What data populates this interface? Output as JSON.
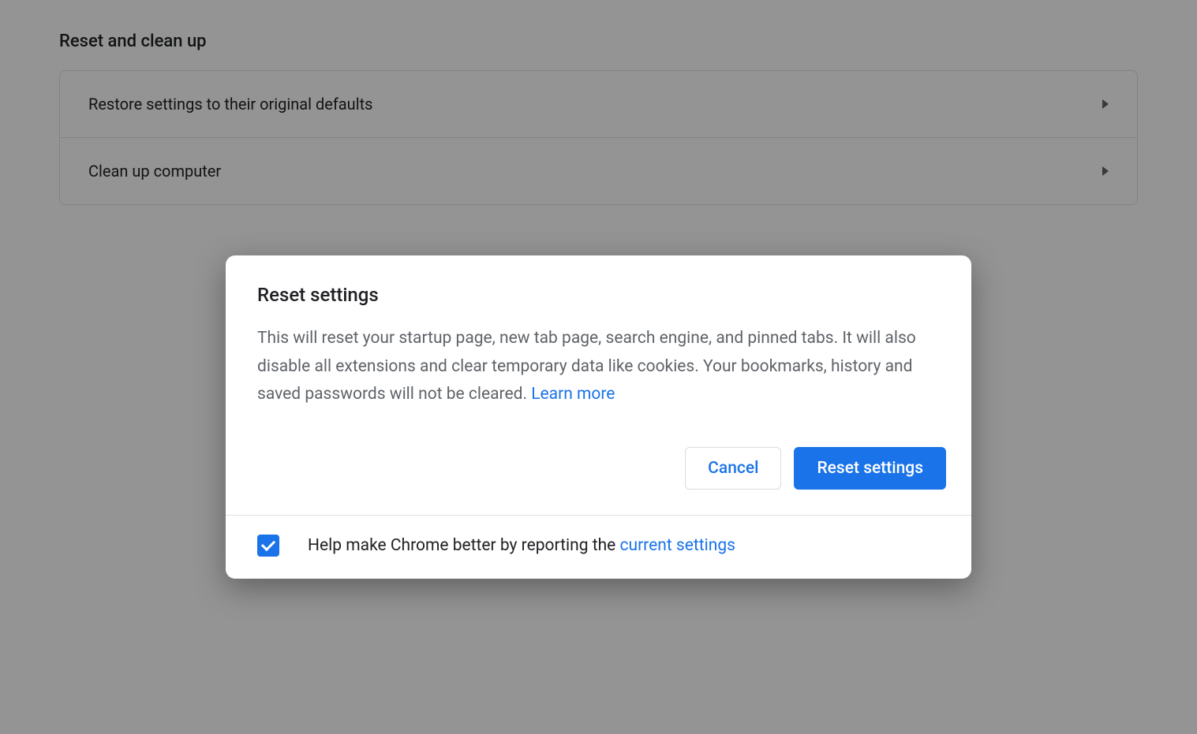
{
  "section": {
    "title": "Reset and clean up",
    "items": [
      {
        "label": "Restore settings to their original defaults"
      },
      {
        "label": "Clean up computer"
      }
    ]
  },
  "dialog": {
    "title": "Reset settings",
    "body_text": "This will reset your startup page, new tab page, search engine, and pinned tabs. It will also disable all extensions and clear temporary data like cookies. Your bookmarks, history and saved passwords will not be cleared. ",
    "learn_more": "Learn more",
    "cancel_label": "Cancel",
    "confirm_label": "Reset settings",
    "footer_text": "Help make Chrome better by reporting the ",
    "footer_link": "current settings",
    "checkbox_checked": true
  }
}
